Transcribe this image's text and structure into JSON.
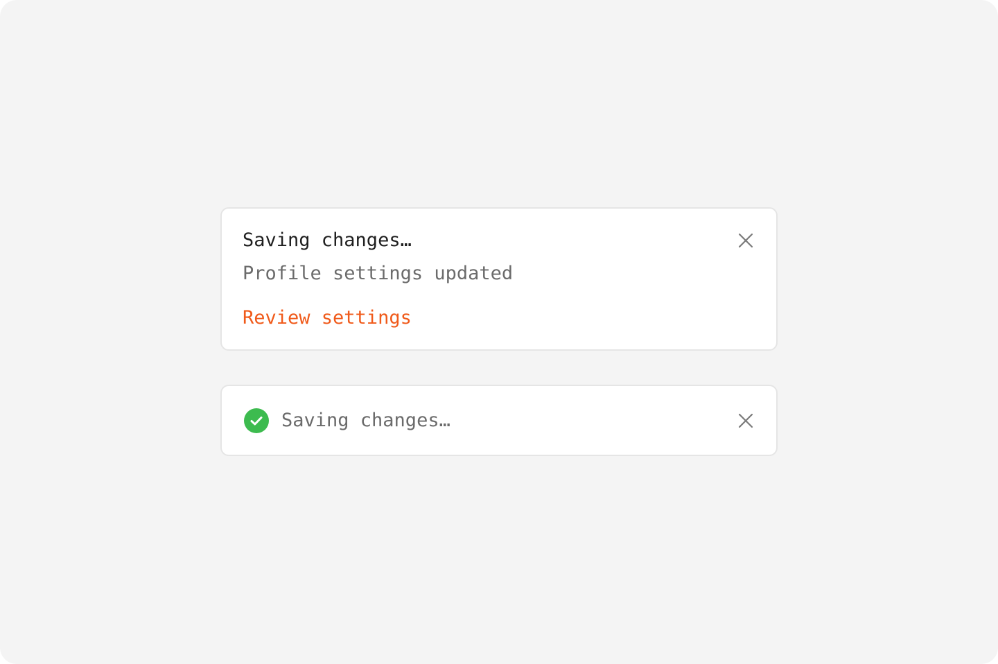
{
  "toasts": {
    "detailed": {
      "title": "Saving changes…",
      "message": "Profile settings updated",
      "action_label": "Review settings",
      "close_icon": "close-icon"
    },
    "compact": {
      "status_icon": "check-circle-icon",
      "text": "Saving changes…",
      "close_icon": "close-icon"
    }
  },
  "colors": {
    "background": "#f4f4f4",
    "card": "#ffffff",
    "border": "#e5e5e5",
    "title_text": "#1f1f1f",
    "secondary_text": "#6b6b6b",
    "accent": "#f05a1a",
    "success": "#3dbb4f"
  }
}
